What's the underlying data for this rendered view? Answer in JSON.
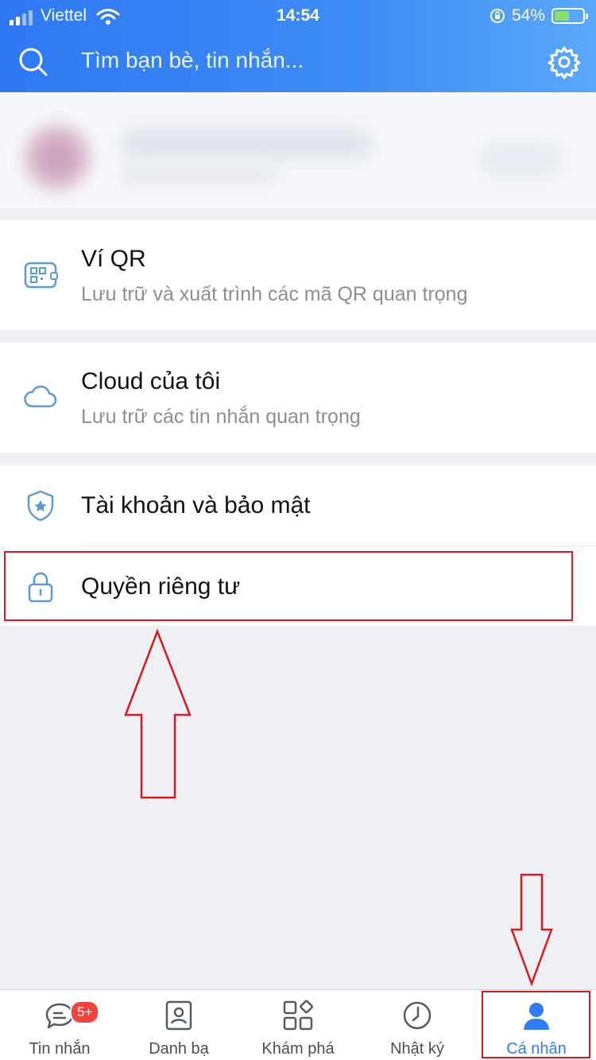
{
  "status_bar": {
    "carrier": "Viettel",
    "time": "14:54",
    "battery": "54%"
  },
  "search": {
    "placeholder": "Tìm bạn bè, tin nhắn..."
  },
  "menu": {
    "qr_wallet": {
      "title": "Ví QR",
      "subtitle": "Lưu trữ và xuất trình các mã QR quan trọng"
    },
    "cloud": {
      "title": "Cloud của tôi",
      "subtitle": "Lưu trữ các tin nhắn quan trọng"
    },
    "account_security": {
      "title": "Tài khoản và bảo mật"
    },
    "privacy": {
      "title": "Quyền riêng tư"
    }
  },
  "bottom_nav": {
    "messages": {
      "label": "Tin nhắn",
      "badge": "5+"
    },
    "contacts": {
      "label": "Danh bạ"
    },
    "discover": {
      "label": "Khám phá"
    },
    "timeline": {
      "label": "Nhật ký"
    },
    "profile": {
      "label": "Cá nhân"
    }
  },
  "colors": {
    "accent": "#2f7cf6",
    "annotation": "#d71920"
  }
}
